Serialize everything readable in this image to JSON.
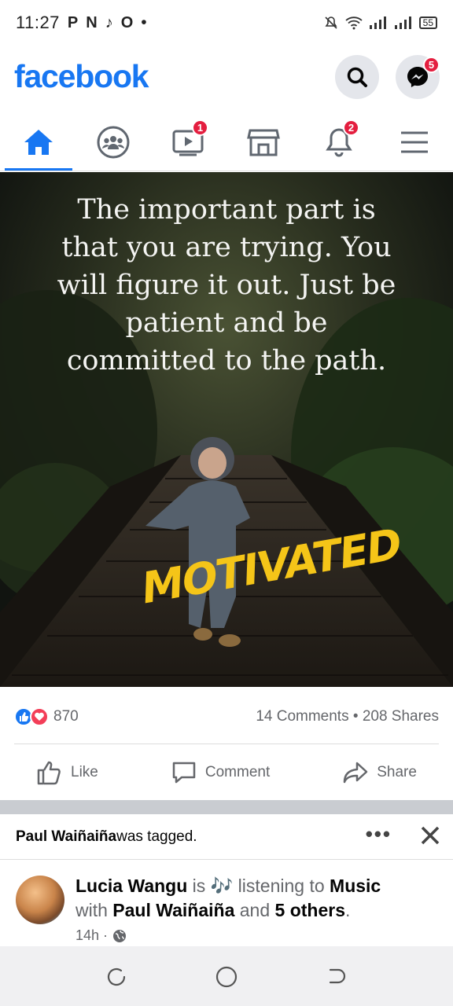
{
  "status_bar": {
    "time": "11:27",
    "left_icons": [
      "P",
      "N",
      "tiktok",
      "O",
      "•"
    ],
    "battery": "55"
  },
  "header": {
    "logo": "facebook",
    "messenger_badge": "5"
  },
  "nav_tabs": [
    {
      "name": "home",
      "badge": ""
    },
    {
      "name": "groups",
      "badge": ""
    },
    {
      "name": "watch",
      "badge": "1"
    },
    {
      "name": "marketplace",
      "badge": ""
    },
    {
      "name": "notifications",
      "badge": "2"
    },
    {
      "name": "menu",
      "badge": ""
    }
  ],
  "post": {
    "quote_lines": [
      "The important part is",
      "that you are trying. You",
      "will figure it out. Just be",
      "patient and be",
      "committed to the path."
    ],
    "brand_stamp": "MOTIVATED",
    "reaction_count": "870",
    "comments": "14 Comments",
    "shares": "208 Shares",
    "separator": "•",
    "actions": {
      "like": "Like",
      "comment": "Comment",
      "share": "Share"
    }
  },
  "next_post": {
    "tag_name": "Paul Waiñaiña",
    "tag_text": " was tagged.",
    "more": "•••",
    "author": "Lucia Wangu",
    "is": " is ",
    "activity": " listening to ",
    "activity_object": "Music",
    "with": "with ",
    "tagged": "Paul Waiñaiña",
    "and": " and ",
    "others": "5 others",
    "period": ".",
    "time": "14h ·"
  },
  "colors": {
    "brand": "#1877f2",
    "badge": "#e41e3f",
    "love": "#f33e58",
    "stamp": "#f5c518"
  }
}
